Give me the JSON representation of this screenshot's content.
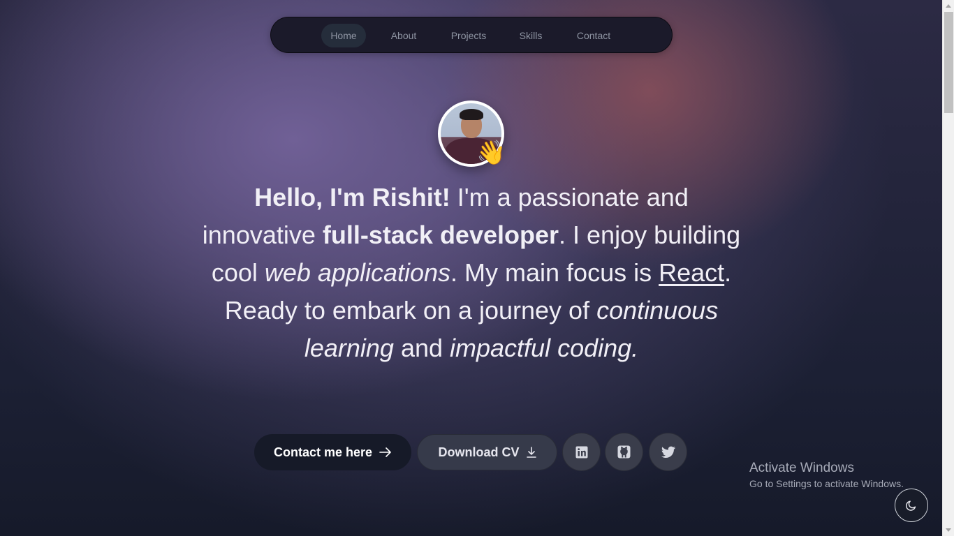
{
  "nav": {
    "items": [
      {
        "label": "Home",
        "active": true
      },
      {
        "label": "About",
        "active": false
      },
      {
        "label": "Projects",
        "active": false
      },
      {
        "label": "Skills",
        "active": false
      },
      {
        "label": "Contact",
        "active": false
      }
    ]
  },
  "hero": {
    "avatar_icon": "waving-hand-icon",
    "intro": {
      "greeting": "Hello, I'm Rishit!",
      "t1": " I'm a passionate and innovative ",
      "role": "full-stack developer",
      "t2": ". I enjoy building cool ",
      "web_apps": "web applications",
      "t3": ". My main focus is ",
      "react": "React",
      "t4": ". Ready to embark on a journey of ",
      "learning": "continuous learning",
      "t5": " and ",
      "impactful": "impactful coding."
    },
    "buttons": {
      "contact_label": "Contact me here",
      "contact_icon": "arrow-right-icon",
      "cv_label": "Download CV",
      "cv_icon": "download-icon"
    },
    "socials": [
      {
        "name": "linkedin-icon"
      },
      {
        "name": "github-icon"
      },
      {
        "name": "twitter-icon"
      }
    ]
  },
  "watermark": {
    "title": "Activate Windows",
    "subtitle": "Go to Settings to activate Windows."
  },
  "theme_toggle": {
    "icon": "moon-icon"
  },
  "colors": {
    "background_dark": "#14182a",
    "nav_bg": "#1b1a2a",
    "primary_button": "#161a28",
    "secondary_button": "#363a4a"
  }
}
